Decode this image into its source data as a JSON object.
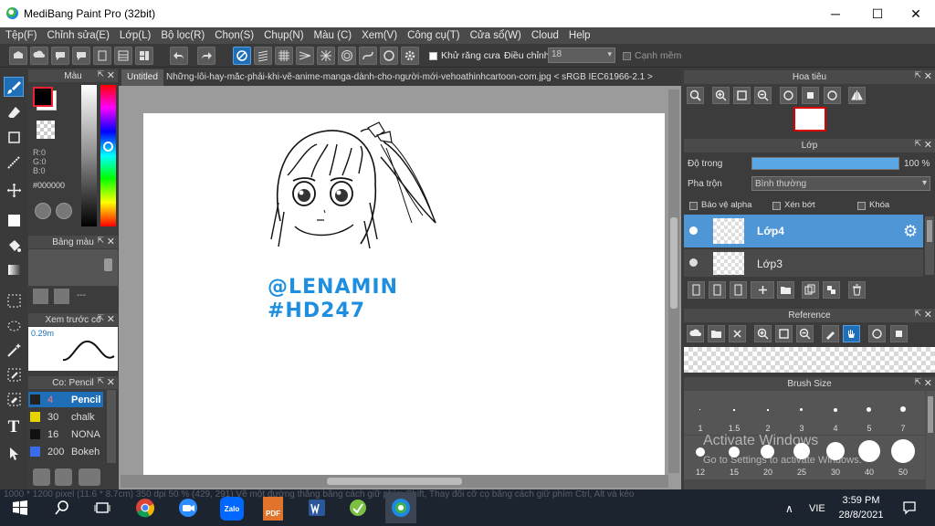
{
  "window": {
    "title": "MediBang Paint Pro (32bit)",
    "minimize": "─",
    "maximize": "☐",
    "close": "✕"
  },
  "menu": [
    "Tệp(F)",
    "Chỉnh sửa(E)",
    "Lớp(L)",
    "Bộ lọc(R)",
    "Chọn(S)",
    "Chụp(N)",
    "Màu (C)",
    "Xem(V)",
    "Công cụ(T)",
    "Cửa sổ(W)",
    "Cloud",
    "Help"
  ],
  "toolbar": {
    "antialias_label": "Khử răng cưa",
    "correction_label": "Điều chỉnh",
    "correction_value": "18",
    "soft_edge_label": "Cạnh mềm"
  },
  "color_panel": {
    "title": "Màu",
    "r": "R:0",
    "g": "G:0",
    "b": "B:0",
    "hex": "#000000",
    "accent": "#1e6fb8"
  },
  "palette_panel": {
    "title": "Bảng màu",
    "dashes": "---"
  },
  "preview_panel": {
    "title": "Xem trước co",
    "size": "0.29m"
  },
  "brush_panel": {
    "title": "Co: Pencil",
    "items": [
      {
        "size": "4",
        "name": "Pencil",
        "color": "#222222",
        "selected": true
      },
      {
        "size": "30",
        "name": "chalk",
        "color": "#e8d400",
        "selected": false
      },
      {
        "size": "16",
        "name": "NONA",
        "color": "#111111",
        "selected": false
      },
      {
        "size": "200",
        "name": "Bokeh",
        "color": "#3a6cf0",
        "selected": false
      }
    ]
  },
  "document": {
    "tab": "Untitled",
    "tab_title": "Những-lỗi-hay-mắc-phải-khi-vẽ-anime-manga-dành-cho-người-mới-vehoathinhcartoon-com.jpg < sRGB IEC61966-2.1 >",
    "text_line1": "@LENAMIN",
    "text_line2": "#HD247",
    "text_color": "#1e8fe0"
  },
  "navigator": {
    "title": "Hoa tiêu"
  },
  "layer_panel": {
    "title": "Lớp",
    "opacity_label": "Độ trong",
    "opacity_value": "100 %",
    "opacity_percent": 100,
    "blend_label": "Pha trộn",
    "blend_value": "Bình thường",
    "protect_alpha": "Bảo vệ alpha",
    "clipping": "Xén bớt",
    "lock": "Khóa",
    "layers": [
      {
        "name": "Lớp4",
        "selected": true
      },
      {
        "name": "Lớp3",
        "selected": false
      }
    ]
  },
  "reference_panel": {
    "title": "Reference"
  },
  "brush_size_panel": {
    "title": "Brush Size",
    "row1": [
      "1",
      "1.5",
      "2",
      "3",
      "4",
      "5",
      "7"
    ],
    "row2": [
      "12",
      "15",
      "20",
      "25",
      "30",
      "40",
      "50"
    ]
  },
  "watermark": {
    "line1": "Activate Windows",
    "line2": "Go to Settings to activate Windows."
  },
  "status_bar": "1000 * 1200 pixel   (11.6 * 8.7cm)   350 dpi   50 %   (429, 291)   Vẽ một đường thẳng bằng cách giữ phím Shift, Thay đổi cỡ cọ bằng cách giữ phím Ctrl, Alt và kéo",
  "taskbar": {
    "lang": "VIE",
    "time": "3:59 PM",
    "date": "28/8/2021",
    "zalo": "Zalo",
    "pdf": "PDF"
  }
}
